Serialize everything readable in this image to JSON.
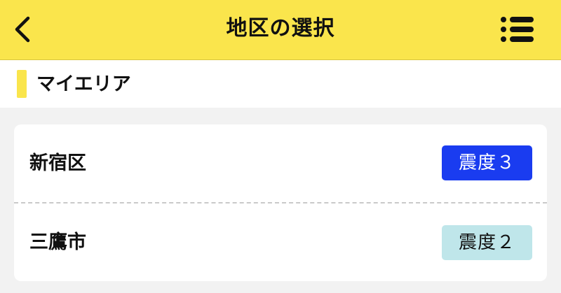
{
  "header": {
    "title": "地区の選択",
    "back_icon": "chevron-left-icon",
    "menu_icon": "list-menu-icon"
  },
  "section": {
    "title": "マイエリア",
    "accent_color": "#fae54c"
  },
  "areas": [
    {
      "name": "新宿区",
      "intensity_label": "震度３",
      "badge_color": "#1a3cf0"
    },
    {
      "name": "三鷹市",
      "intensity_label": "震度２",
      "badge_color": "#bfe6ea"
    }
  ]
}
